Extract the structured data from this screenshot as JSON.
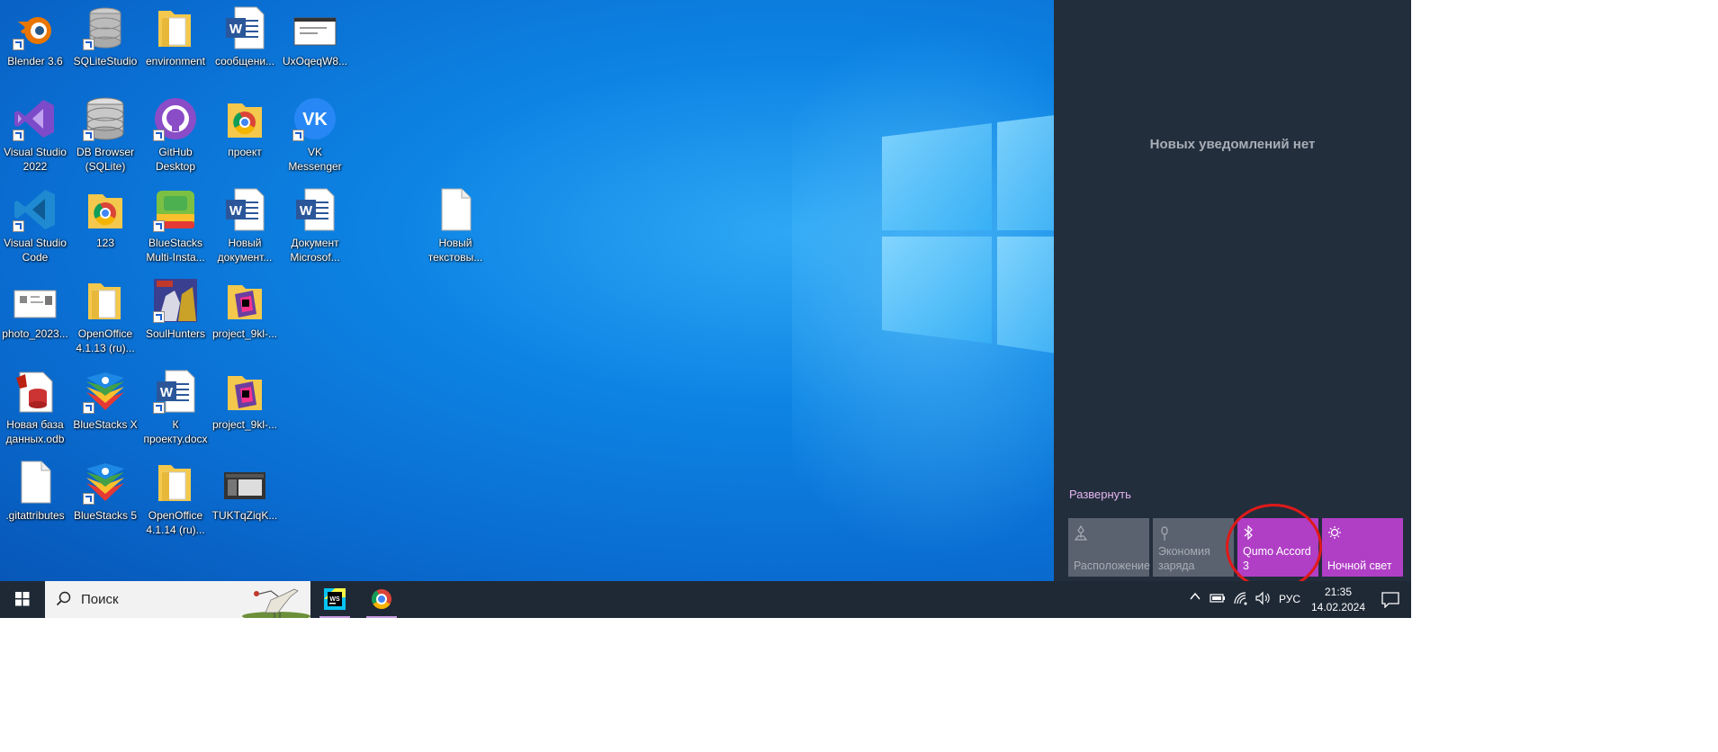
{
  "desktop": {
    "icons": [
      {
        "label": "Blender 3.6",
        "icon": "blender-icon"
      },
      {
        "label": "SQLiteStudio",
        "icon": "database-icon"
      },
      {
        "label": "environment",
        "icon": "folder-icon"
      },
      {
        "label": "сообщени...",
        "icon": "word-doc-icon"
      },
      {
        "label": "UxOqeqW8...",
        "icon": "image-thumbnail-icon"
      },
      {
        "label": "Visual Studio 2022",
        "icon": "visual-studio-icon"
      },
      {
        "label": "DB Browser (SQLite)",
        "icon": "database-icon"
      },
      {
        "label": "GitHub Desktop",
        "icon": "github-icon"
      },
      {
        "label": "проект",
        "icon": "chrome-folder-icon"
      },
      {
        "label": "VK Messenger",
        "icon": "vk-icon"
      },
      {
        "label": "Visual Studio Code",
        "icon": "vscode-icon"
      },
      {
        "label": "123",
        "icon": "chrome-folder-icon"
      },
      {
        "label": "BlueStacks Multi-Insta...",
        "icon": "bluestacks-multi-icon"
      },
      {
        "label": "Новый документ...",
        "icon": "word-doc-icon"
      },
      {
        "label": "Документ Microsof...",
        "icon": "word-doc-icon"
      },
      {
        "label": "Новый текстовы...",
        "icon": "text-file-icon"
      },
      {
        "label": "photo_2023...",
        "icon": "image-thumbnail-icon"
      },
      {
        "label": "OpenOffice 4.1.13 (ru)...",
        "icon": "folder-icon"
      },
      {
        "label": "SoulHunters",
        "icon": "game-icon"
      },
      {
        "label": "project_9kl-...",
        "icon": "jetbrains-folder-icon"
      },
      {
        "label": "Новая база данных.odb",
        "icon": "odb-file-icon"
      },
      {
        "label": "BlueStacks X",
        "icon": "bluestacks-icon"
      },
      {
        "label": "К проекту.docx",
        "icon": "word-doc-icon"
      },
      {
        "label": "project_9kl-...",
        "icon": "jetbrains-folder-icon"
      },
      {
        "label": ".gitattributes",
        "icon": "text-file-icon"
      },
      {
        "label": "BlueStacks 5",
        "icon": "bluestacks-icon"
      },
      {
        "label": "OpenOffice 4.1.14 (ru)...",
        "icon": "folder-icon"
      },
      {
        "label": "TUKTqZiqK...",
        "icon": "image-thumbnail-icon"
      }
    ]
  },
  "action_center": {
    "empty_message": "Новых уведомлений нет",
    "expand_label": "Развернуть",
    "tiles": [
      {
        "label": "Расположение",
        "icon": "location-icon",
        "state": "off"
      },
      {
        "label": "Экономия заряда",
        "icon": "battery-saver-icon",
        "state": "off"
      },
      {
        "label": "Qumo Accord 3",
        "icon": "bluetooth-icon",
        "state": "on"
      },
      {
        "label": "Ночной свет",
        "icon": "night-light-icon",
        "state": "on"
      }
    ],
    "accent_color": "#b03fc6"
  },
  "taskbar": {
    "search_placeholder": "Поиск",
    "apps": [
      {
        "name": "WebStorm",
        "icon": "webstorm-icon"
      },
      {
        "name": "Google Chrome",
        "icon": "chrome-icon"
      }
    ],
    "language": "РУС",
    "time": "21:35",
    "date": "14.02.2024"
  }
}
